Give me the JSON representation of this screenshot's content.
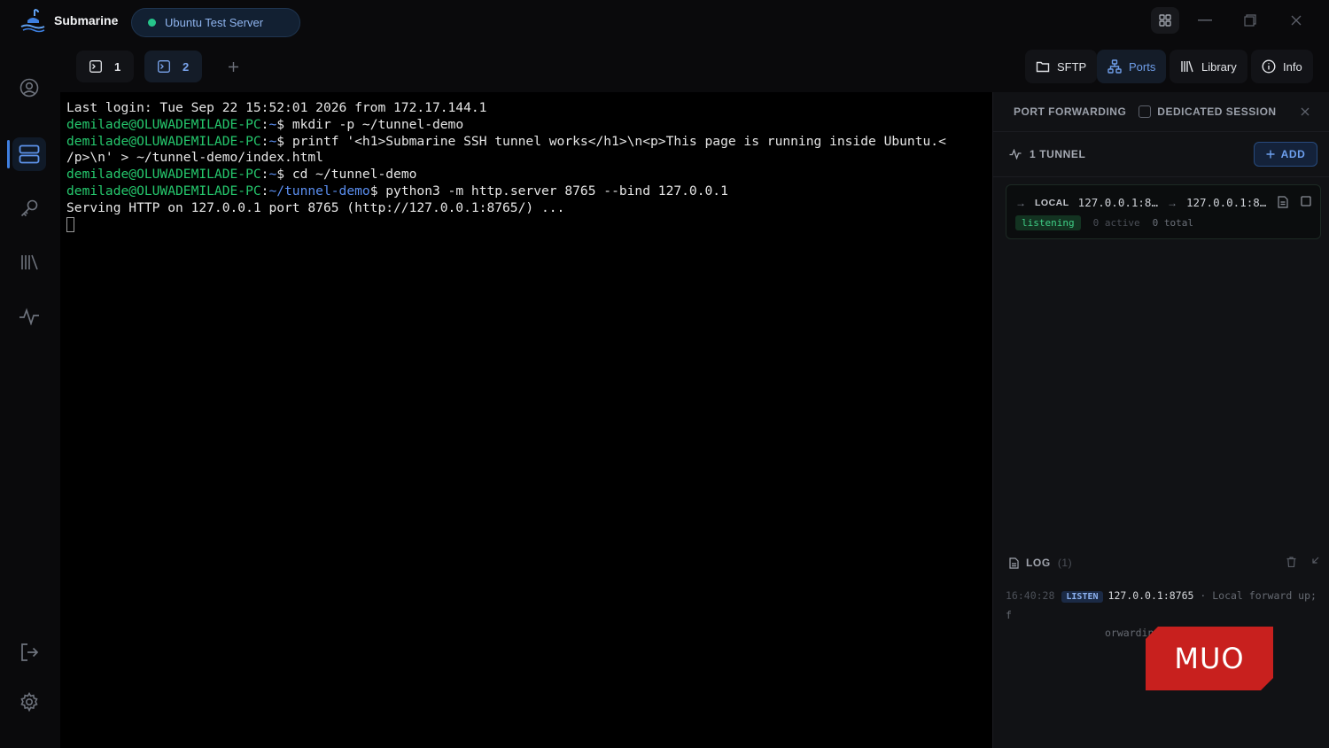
{
  "app": {
    "name": "Submarine"
  },
  "server": {
    "name": "Ubuntu Test Server",
    "status_color": "#26c48a"
  },
  "tabs": [
    {
      "label": "1",
      "active": false
    },
    {
      "label": "2",
      "active": true
    }
  ],
  "toolbar": {
    "sftp": "SFTP",
    "ports": "Ports",
    "library": "Library",
    "info": "Info"
  },
  "rail_icons": [
    "user-icon",
    "servers-icon",
    "key-icon",
    "library-icon",
    "activity-icon",
    "logout-icon",
    "settings-icon"
  ],
  "terminal": {
    "line1": "Last login: Tue Sep 22 15:52:01 2026 from 172.17.144.1",
    "prompt_user": "demilade@OLUWADEMILADE-PC",
    "home": "~",
    "tunnel_path": "~/tunnel-demo",
    "cmd1": "mkdir -p ~/tunnel-demo",
    "cmd2a": "printf '<h1>Submarine SSH tunnel works</h1>\\n<p>This page is running inside Ubuntu.<",
    "cmd2b": "/p>\\n' > ~/tunnel-demo/index.html",
    "cmd3": "cd ~/tunnel-demo",
    "cmd4": "python3 -m http.server 8765 --bind 127.0.0.1",
    "output": "Serving HTTP on 127.0.0.1 port 8765 (http://127.0.0.1:8765/) ..."
  },
  "panel": {
    "title": "PORT FORWARDING",
    "dedicated": "DEDICATED SESSION",
    "tunnel_count": "1 TUNNEL",
    "add": "ADD",
    "tunnel": {
      "type": "LOCAL",
      "from": "127.0.0.1:8…",
      "to": "127.0.0.1:8…",
      "status": "listening",
      "active": "0 active",
      "total": "0 total"
    },
    "log": {
      "title": "LOG",
      "count": "(1)",
      "time": "16:40:28",
      "tag": "LISTEN",
      "addr": "127.0.0.1:8765",
      "msg1": "· Local forward up; f",
      "msg2": "orwarding to 127.0.0.1:8765"
    }
  },
  "watermark": {
    "text": "MUO",
    "color": "#c8201e"
  }
}
